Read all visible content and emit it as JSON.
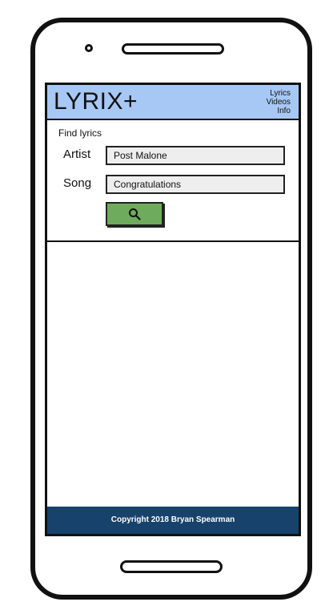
{
  "app": {
    "logo": "LYRIX+"
  },
  "nav": {
    "items": [
      "Lyrics",
      "Videos",
      "Info"
    ]
  },
  "search": {
    "heading": "Find lyrics",
    "artist_label": "Artist",
    "artist_value": "Post Malone",
    "song_label": "Song",
    "song_value": "Congratulations",
    "button_icon": "search-icon"
  },
  "footer": {
    "text": "Copyright 2018 Bryan Spearman"
  },
  "colors": {
    "header_bg": "#a7c7f5",
    "button_bg": "#6fab5c",
    "footer_bg": "#17426b",
    "input_bg": "#eeeeee"
  }
}
